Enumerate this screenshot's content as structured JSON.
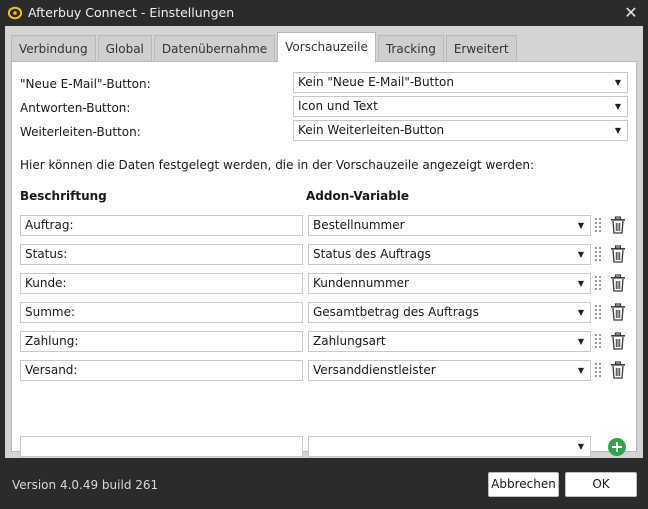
{
  "window": {
    "title": "Afterbuy Connect - Einstellungen",
    "close_label": "✕"
  },
  "tabs": [
    {
      "label": "Verbindung"
    },
    {
      "label": "Global"
    },
    {
      "label": "Datenübernahme"
    },
    {
      "label": "Vorschauzeile",
      "active": true
    },
    {
      "label": "Tracking"
    },
    {
      "label": "Erweitert"
    }
  ],
  "settings": {
    "new_email_label": "\"Neue E-Mail\"-Button:",
    "new_email_value": "Kein \"Neue E-Mail\"-Button",
    "reply_label": "Antworten-Button:",
    "reply_value": "Icon und Text",
    "forward_label": "Weiterleiten-Button:",
    "forward_value": "Kein Weiterleiten-Button"
  },
  "info_text": "Hier können die Daten festgelegt werden, die in der Vorschauzeile angezeigt werden:",
  "columns": {
    "caption_header": "Beschriftung",
    "variable_header": "Addon-Variable"
  },
  "rows": [
    {
      "caption": "Auftrag:",
      "variable": "Bestellnummer"
    },
    {
      "caption": "Status:",
      "variable": "Status des Auftrags"
    },
    {
      "caption": "Kunde:",
      "variable": "Kundennummer"
    },
    {
      "caption": "Summe:",
      "variable": "Gesamtbetrag des Auftrags"
    },
    {
      "caption": "Zahlung:",
      "variable": "Zahlungsart"
    },
    {
      "caption": "Versand:",
      "variable": "Versanddienstleister"
    }
  ],
  "new_row": {
    "caption": "",
    "variable": ""
  },
  "footer": {
    "version": "Version 4.0.49 build 261",
    "cancel_label": "Abbrechen",
    "ok_label": "OK"
  },
  "colors": {
    "titlebar": "#2b2b2b",
    "content_bg": "#d4d4d4",
    "panel_bg": "#ffffff",
    "add_button": "#2ea44f",
    "app_icon": "#f2c300"
  },
  "icons": {
    "app": "afterbuy-logo-icon",
    "close": "close-icon",
    "dropdown": "chevron-down-icon",
    "drag": "drag-handle-icon",
    "delete": "trash-icon",
    "add": "plus-circle-icon"
  }
}
